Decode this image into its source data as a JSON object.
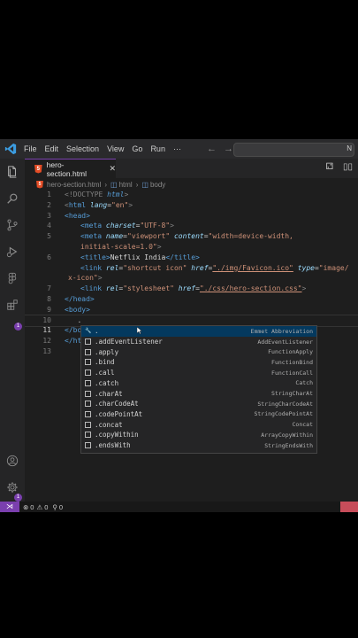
{
  "menu": [
    "File",
    "Edit",
    "Selection",
    "View",
    "Go",
    "Run",
    "···"
  ],
  "search_text": "N",
  "tab": {
    "icon": "5",
    "label": "hero-section.html",
    "close": "✕"
  },
  "breadcrumb": {
    "file": "hero-section.html",
    "html": "html",
    "body": "body"
  },
  "line_numbers": [
    "1",
    "2",
    "3",
    "4",
    "5",
    "",
    "6",
    "",
    "7",
    "8",
    "9",
    "10",
    "11",
    "12",
    "13"
  ],
  "code": {
    "l1_doctype": "<!DOCTYPE ",
    "l1_html": "html",
    "l1_close": ">",
    "l2_open": "<",
    "l2_tag": "html ",
    "l2_attr": "lang",
    "l2_eq": "=",
    "l2_val": "\"en\"",
    "l2_close": ">",
    "l3": "<head>",
    "l4_tag": "<meta ",
    "l4_attr": "charset",
    "l4_val": "\"UTF-8\"",
    "l4_close": ">",
    "l5_tag": "<meta ",
    "l5_attr1": "name",
    "l5_val1": "\"viewport\"",
    "l5_attr2": " content",
    "l5_val2": "\"width=device-width,",
    "l5b_val": "initial-scale=1.0\"",
    "l5b_close": ">",
    "l6_open": "<title>",
    "l6_text": "Netflix India",
    "l6_close": "</title>",
    "l7_tag": "<link ",
    "l7_attr1": "rel",
    "l7_val1": "\"shortcut icon\"",
    "l7_attr2": " href",
    "l7_val2": "\"./img/Favicon.ico\"",
    "l7_attr3": " type",
    "l7_val3": "\"image/",
    "l7b_val": "x-icon\"",
    "l7b_close": ">",
    "l8_tag": "<link ",
    "l8_attr1": "rel",
    "l8_val1": "\"stylesheet\"",
    "l8_attr2": " href",
    "l8_val2": "\"./css/hero-section.css\"",
    "l8_close": ">",
    "l9": "</head>",
    "l10": "<body>",
    "l11": "   .",
    "l12": "</bo",
    "l13": "</ht"
  },
  "suggestions": [
    {
      "label": ".",
      "detail": "Emmet Abbreviation"
    },
    {
      "label": ".addEventListener",
      "detail": "AddEventListener"
    },
    {
      "label": ".apply",
      "detail": "FunctionApply"
    },
    {
      "label": ".bind",
      "detail": "FunctionBind"
    },
    {
      "label": ".call",
      "detail": "FunctionCall"
    },
    {
      "label": ".catch",
      "detail": "Catch"
    },
    {
      "label": ".charAt",
      "detail": "StringCharAt"
    },
    {
      "label": ".charCodeAt",
      "detail": "StringCharCodeAt"
    },
    {
      "label": ".codePointAt",
      "detail": "StringCodePointAt"
    },
    {
      "label": ".concat",
      "detail": "Concat"
    },
    {
      "label": ".copyWithin",
      "detail": "ArrayCopyWithin"
    },
    {
      "label": ".endsWith",
      "detail": "StringEndsWith"
    }
  ],
  "status": {
    "errors": "0",
    "warnings": "0",
    "ports": "0"
  },
  "badge": "1",
  "colors": {
    "accent": "#7a3fae",
    "editor_bg": "#1e1e1e",
    "tag": "#569cd6",
    "attr": "#9cdcfe",
    "string": "#ce9178"
  }
}
